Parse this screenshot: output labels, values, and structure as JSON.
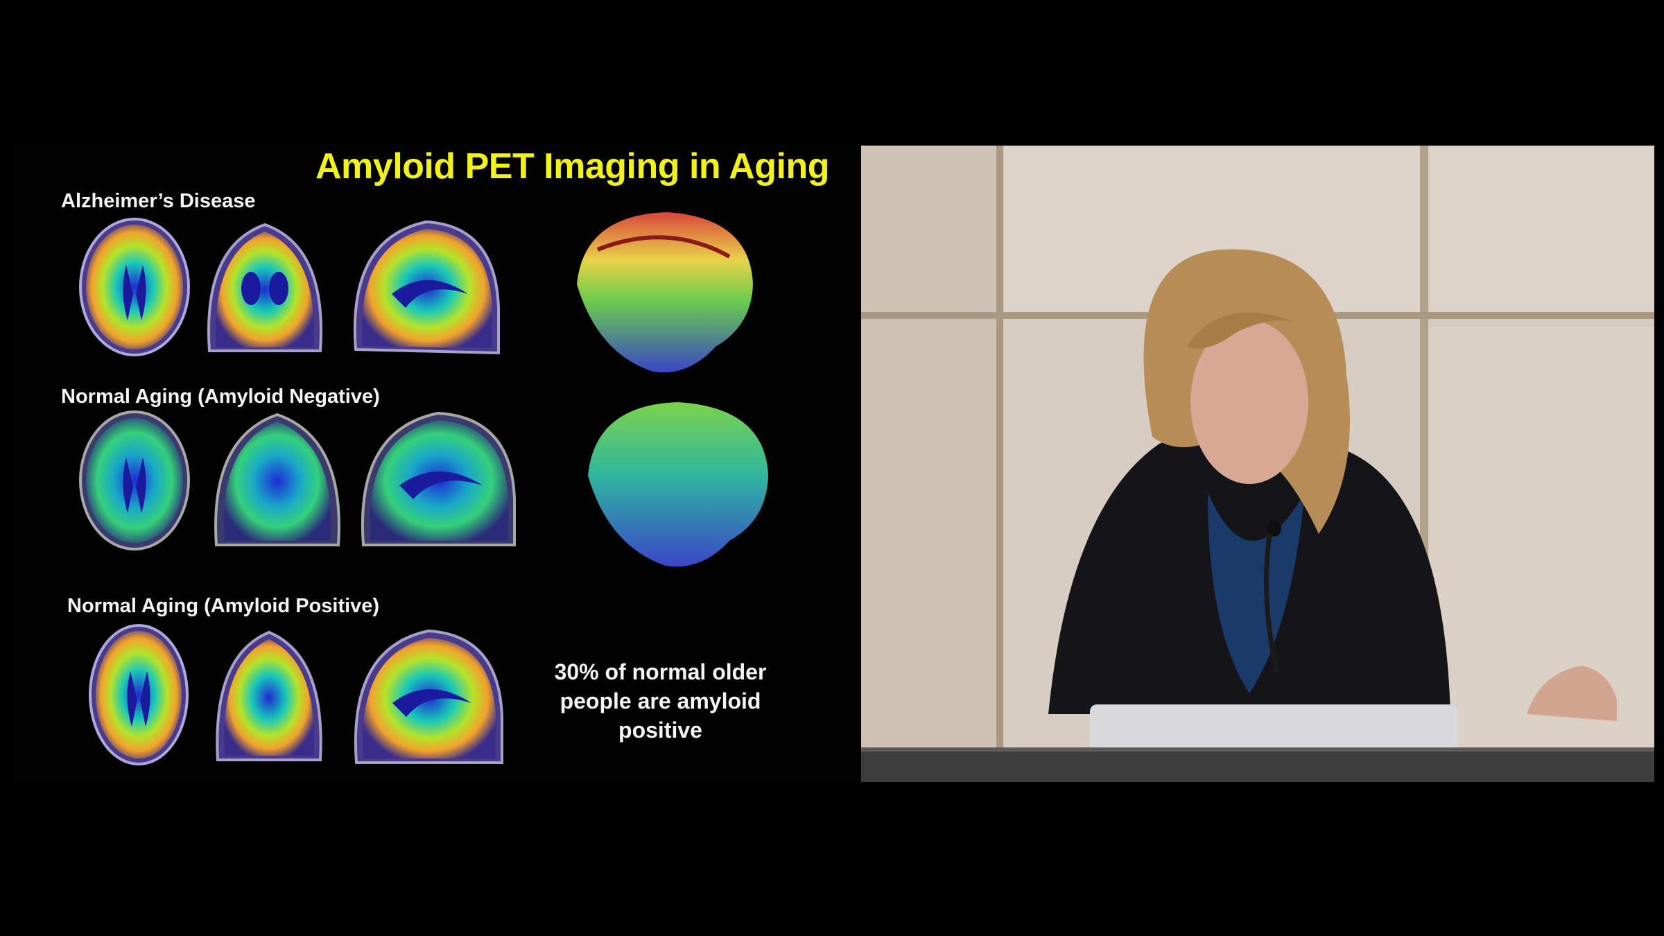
{
  "slide": {
    "title": "Amyloid PET Imaging in Aging",
    "rows": [
      {
        "label": "Alzheimer’s Disease"
      },
      {
        "label": "Normal Aging (Amyloid Negative)"
      },
      {
        "label": "Normal Aging (Amyloid Positive)"
      }
    ],
    "caption": "30% of normal older people are amyloid positive",
    "colors": {
      "title": "#f2f21a",
      "text": "#f4f4f4",
      "background": "#000000"
    }
  },
  "speaker_video": {
    "icons": [
      "speaker-person-image",
      "microphone-icon",
      "laptop-icon"
    ]
  }
}
